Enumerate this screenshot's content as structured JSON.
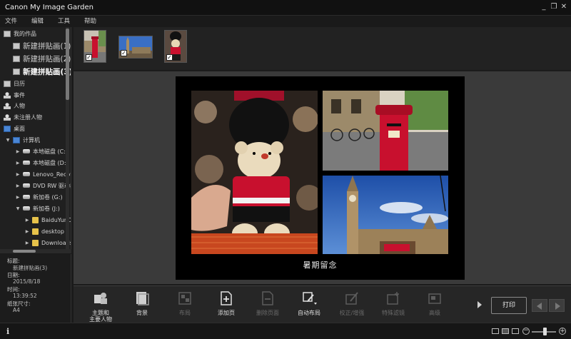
{
  "app": {
    "title": "Canon My Image Garden"
  },
  "window_controls": {
    "minimize": "_",
    "restore": "❐",
    "close": "✕"
  },
  "menu": [
    "文件",
    "编辑",
    "工具",
    "帮助"
  ],
  "sidebar": {
    "items": [
      {
        "label": "我的作品",
        "icon": "my-works-icon"
      },
      {
        "label": "新建拼贴画(1)",
        "icon": "collage-icon"
      },
      {
        "label": "新建拼贴画(2)",
        "icon": "collage-icon"
      },
      {
        "label": "新建拼贴画(3)",
        "icon": "collage-icon",
        "selected": true
      },
      {
        "label": "日历",
        "icon": "calendar-icon"
      },
      {
        "label": "事件",
        "icon": "event-icon"
      },
      {
        "label": "人物",
        "icon": "person-icon"
      },
      {
        "label": "未注册人物",
        "icon": "unregistered-person-icon"
      },
      {
        "label": "桌面",
        "icon": "desktop-icon"
      },
      {
        "label": "计算机",
        "icon": "computer-icon"
      },
      {
        "label": "本地磁盘 (C:)",
        "icon": "drive-icon"
      },
      {
        "label": "本地磁盘 (D:)",
        "icon": "drive-icon"
      },
      {
        "label": "Lenovo_Recovery",
        "icon": "drive-icon"
      },
      {
        "label": "DVD RW 驱动器",
        "icon": "dvd-icon"
      },
      {
        "label": "新加卷 (G:)",
        "icon": "drive-icon"
      },
      {
        "label": "新加卷 (J:)",
        "icon": "drive-icon"
      },
      {
        "label": "BaiduYunDownload",
        "icon": "folder-icon"
      },
      {
        "label": "desktop",
        "icon": "folder-icon"
      },
      {
        "label": "Downloads",
        "icon": "folder-icon"
      }
    ]
  },
  "info": {
    "title_label": "标题:",
    "title_value": "新建拼贴画(3)",
    "date_label": "日期:",
    "date_value": "2015/8/18",
    "time_label": "时间:",
    "time_value": "13:39:52",
    "paper_label": "纸张尺寸:",
    "paper_value": "A4"
  },
  "thumbnails": [
    {
      "name": "red-postbox",
      "checked": "✓"
    },
    {
      "name": "big-ben",
      "checked": "✓"
    },
    {
      "name": "teddy-bear",
      "checked": "✓"
    }
  ],
  "page": {
    "caption": "暑期留念"
  },
  "toolbar": {
    "tools": [
      {
        "label": "主题和\n主要人物",
        "label1": "主题和",
        "label2": "主要人物",
        "enabled": true
      },
      {
        "label1": "背景",
        "label2": "",
        "enabled": true
      },
      {
        "label1": "布局",
        "label2": "",
        "enabled": false
      },
      {
        "label1": "添加页",
        "label2": "",
        "enabled": true
      },
      {
        "label1": "删除页面",
        "label2": "",
        "enabled": false
      },
      {
        "label1": "自动布局",
        "label2": "",
        "enabled": true
      },
      {
        "label1": "校正/增强",
        "label2": "",
        "enabled": false
      },
      {
        "label1": "特殊滤镜",
        "label2": "",
        "enabled": false
      },
      {
        "label1": "高级",
        "label2": "",
        "enabled": false
      }
    ],
    "print_label": "打印"
  },
  "statusbar": {
    "info_icon": "i"
  },
  "colors": {
    "background": "#1b1b1b",
    "panel": "#202020",
    "canvas": "#3a3a3a",
    "accent_red": "#c8102e"
  }
}
